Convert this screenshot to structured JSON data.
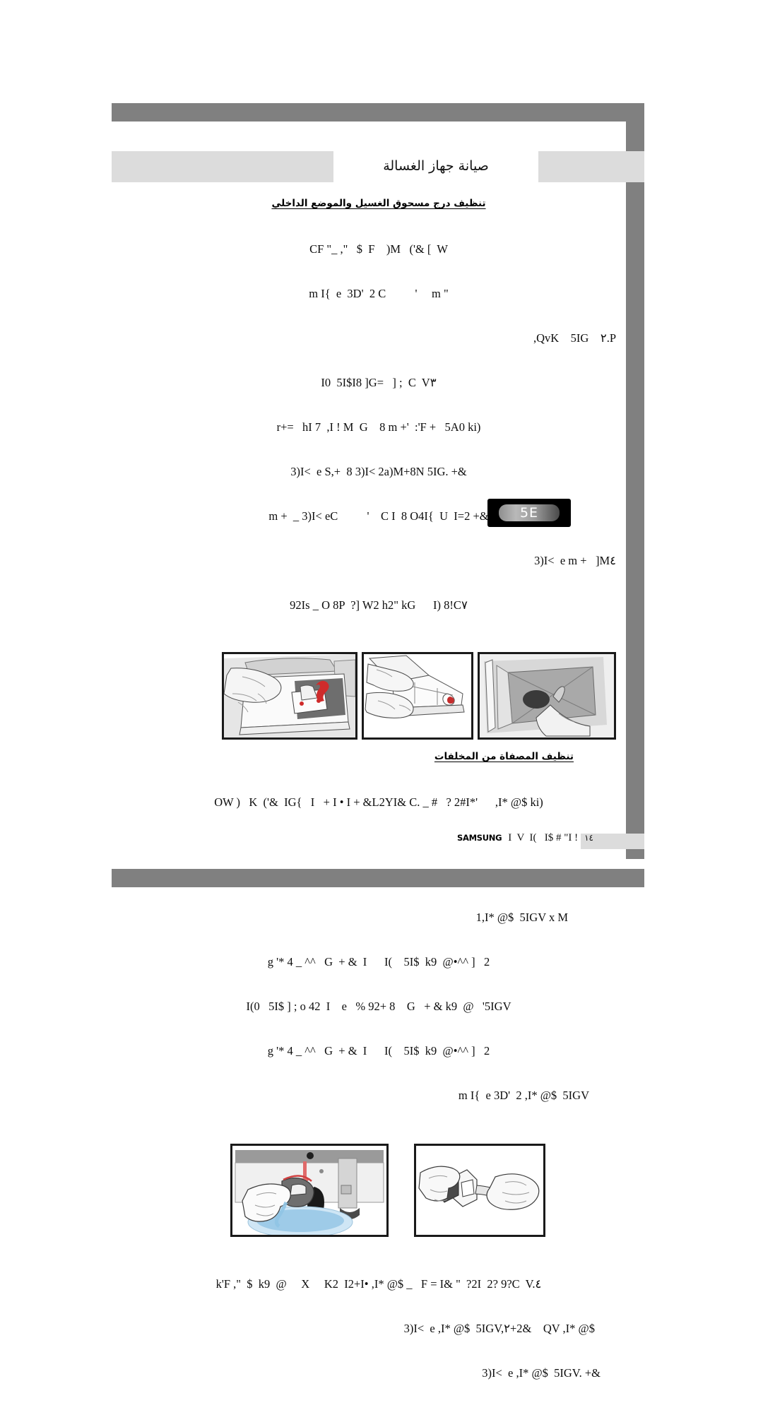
{
  "document": {
    "title": "صيانة جهاز الغسالة",
    "language": "ar"
  },
  "sections": [
    {
      "heading": "تنظيف درج مسحوق الغسيل والموضع الداخلي",
      "lines": [
        "CF \"_ ,\"   $  F    )M   ('& [  W",
        "m I{  e  3D'  2 C          '     m \"",
        ",QvK    5IG    ٢.P",
        "I0  5I$I8 ]G=   ] ;  C  V٣",
        "r+=   hI 7  ,I ! M  G    8 m +'  :'F +   5A0 ki)",
        "3)I<  e S,+  8 3)I< 2a)M+8N 5IG. +&",
        "m +  _ 3)I< eC          '    C I  8 O4I{  U  I=2 +&",
        "3)I<  e m +   ]M٤",
        "92Is _ O 8P  ?] W2 h2\" kG      I) 8!C٧"
      ]
    },
    {
      "heading": "تنظيف المصفاة من المخلفات",
      "lines": [
        "OW )   K  ('&  IG{   I   + I • I + &L2YI& C. _ #   ? 2#I*'      ,I* @$ ki)"
      ]
    },
    {
      "heading": null,
      "lines": [
        "1,I* @$  5IGV x M",
        "g '* 4 _ ^^   G  + &  I      I(    5I$  k9  @•^^ ]   2",
        "I(0   5I$ ] ; o 42  I    e   % 92+ 8    G   + & k9  @   '5IGV",
        "g '* 4 _ ^^   G  + &  I      I(    5I$  k9  @•^^ ]   2",
        "m I{  e 3D'  2 ,I* @$  5IGV"
      ]
    },
    {
      "heading": null,
      "lines": [
        "k'F ,\"  $  k9  @     X     K2  I2+I• ,I* @$ _   F = I& \"  ?2I  2? 9?C  V.٤",
        "3)I<  e ,I* @$  5IGV,٢+2&    QV ,I* @$",
        "3)I<  e ,I* @$  5IGV. +&"
      ]
    }
  ],
  "display_panel": {
    "code": "5E",
    "label": "error-code-display"
  },
  "figures": {
    "row1": [
      {
        "name": "drawer-recess-cleaning",
        "caption": null
      },
      {
        "name": "detergent-drawer-removal",
        "caption": null
      },
      {
        "name": "drawer-compartment-insert",
        "caption": null
      }
    ],
    "row2": [
      {
        "name": "filter-cap-cleaning",
        "caption": null
      },
      {
        "name": "drain-filter-water-release",
        "caption": null
      }
    ]
  },
  "footer": {
    "brand": "SAMSUNG",
    "text": "I  V  I(   I$ # \"I !",
    "page": "١٤"
  },
  "colors": {
    "frame_gray": "#808080",
    "band_light": "#dcdcdc",
    "display_black": "#000000",
    "accent_red": "#cc2222",
    "water_blue": "#9ecbe8"
  }
}
